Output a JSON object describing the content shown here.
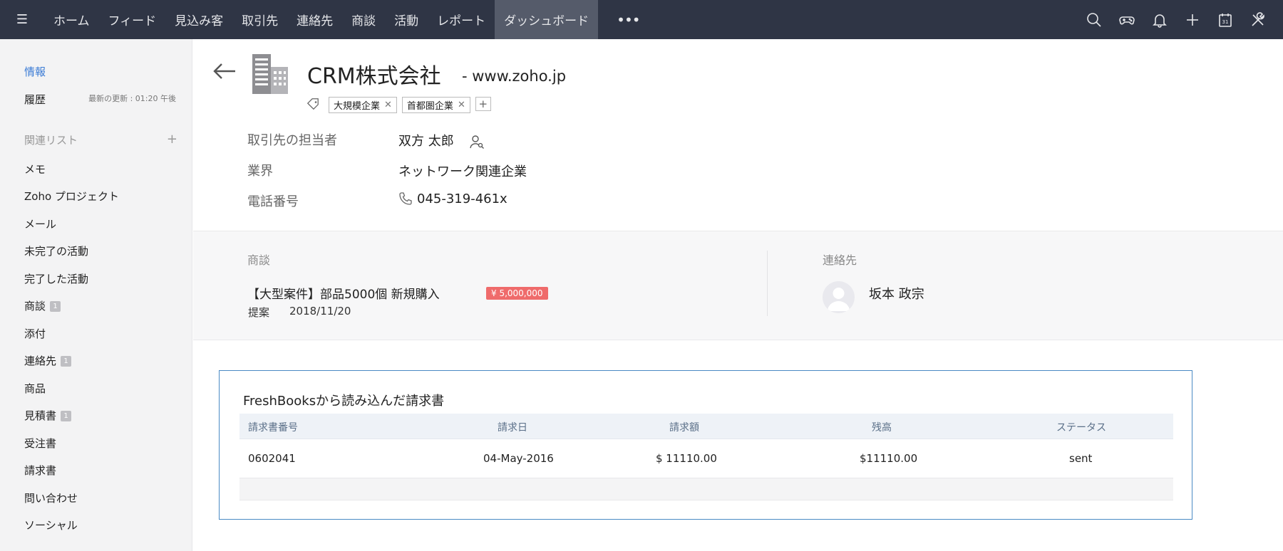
{
  "nav": {
    "items": [
      "ホーム",
      "フィード",
      "見込み客",
      "取引先",
      "連絡先",
      "商談",
      "活動",
      "レポート",
      "ダッシュボード"
    ],
    "active_index": 8,
    "more": "•••",
    "right_icons": [
      "search-icon",
      "gamepad-icon",
      "bell-icon",
      "plus-icon",
      "calendar-icon",
      "tools-icon"
    ],
    "calendar_day": "31"
  },
  "sidebar": {
    "info": "情報",
    "history": "履歴",
    "last_updated": "最新の更新 : 01:20 午後",
    "related_lists": "関連リスト",
    "items": [
      {
        "label": "メモ"
      },
      {
        "label": "Zoho プロジェクト"
      },
      {
        "label": "メール"
      },
      {
        "label": "未完了の活動"
      },
      {
        "label": "完了した活動"
      },
      {
        "label": "商談",
        "badge": "1"
      },
      {
        "label": "添付"
      },
      {
        "label": "連絡先",
        "badge": "1"
      },
      {
        "label": "商品"
      },
      {
        "label": "見積書",
        "badge": "1"
      },
      {
        "label": "受注書"
      },
      {
        "label": "請求書"
      },
      {
        "label": "問い合わせ"
      },
      {
        "label": "ソーシャル"
      }
    ]
  },
  "account": {
    "name": "CRM株式会社",
    "website": "- www.zoho.jp",
    "tags": [
      "大規模企業",
      "首都圏企業"
    ],
    "fields": [
      {
        "label": "取引先の担当者",
        "value": "双方 太郎"
      },
      {
        "label": "業界",
        "value": "ネットワーク関連企業"
      },
      {
        "label": "電話番号",
        "value": "045-319-461x"
      }
    ]
  },
  "deals": {
    "label": "商談",
    "name": "【大型案件】部品5000個 新規購入",
    "amount": "¥ 5,000,000",
    "stage": "提案",
    "date": "2018/11/20"
  },
  "contacts": {
    "label": "連絡先",
    "name": "坂本 政宗"
  },
  "invoices": {
    "title": "FreshBooksから読み込んだ請求書",
    "headers": [
      "請求書番号",
      "請求日",
      "請求額",
      "残高",
      "ステータス"
    ],
    "rows": [
      [
        "0602041",
        "04-May-2016",
        "$ 11110.00",
        "$11110.00",
        "sent"
      ]
    ]
  },
  "colors": {
    "nav_bg": "#2f3545",
    "nav_active": "#555b6a",
    "link_blue": "#3a7bd5",
    "amount_red": "#ef6b6b",
    "box_border": "#4a8ac4"
  }
}
